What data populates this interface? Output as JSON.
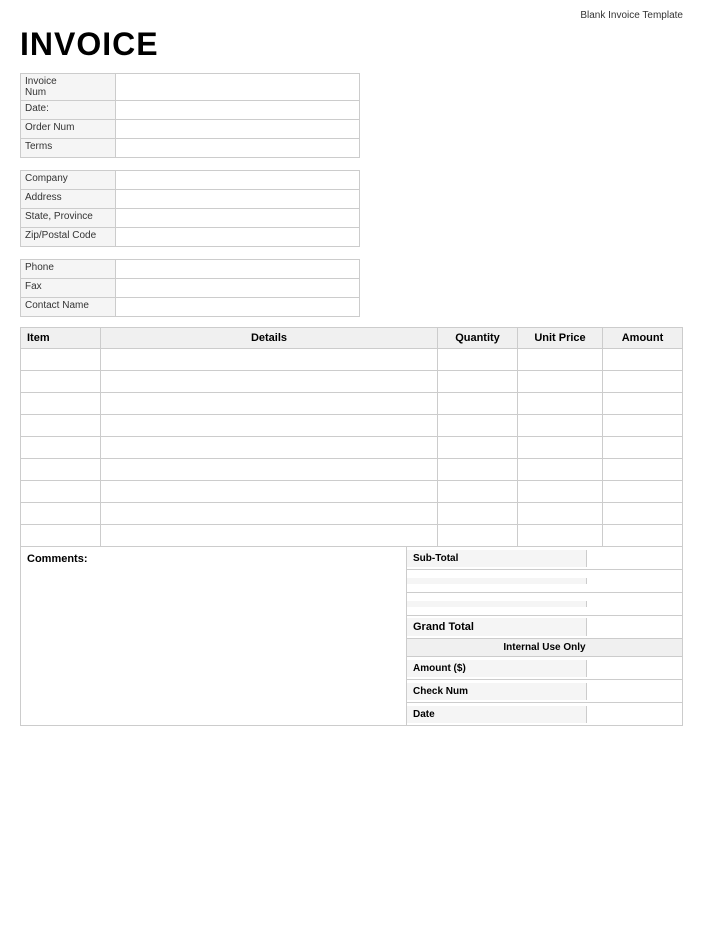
{
  "page": {
    "top_label": "Blank Invoice Template",
    "title": "INVOICE"
  },
  "info_sections": {
    "section1": [
      {
        "label": "Invoice\nNum",
        "value": ""
      },
      {
        "label": "Date:",
        "value": ""
      },
      {
        "label": "Order Num",
        "value": ""
      },
      {
        "label": "Terms",
        "value": ""
      }
    ],
    "section2": [
      {
        "label": "Company",
        "value": ""
      },
      {
        "label": "Address",
        "value": ""
      },
      {
        "label": "State, Province",
        "value": ""
      },
      {
        "label": "Zip/Postal Code",
        "value": ""
      }
    ],
    "section3": [
      {
        "label": "Phone",
        "value": ""
      },
      {
        "label": "Fax",
        "value": ""
      },
      {
        "label": "Contact Name",
        "value": ""
      }
    ]
  },
  "table": {
    "headers": {
      "item": "Item",
      "details": "Details",
      "quantity": "Quantity",
      "unit_price": "Unit Price",
      "amount": "Amount"
    },
    "rows": [
      {
        "item": "",
        "details": "",
        "quantity": "",
        "unit_price": "",
        "amount": ""
      },
      {
        "item": "",
        "details": "",
        "quantity": "",
        "unit_price": "",
        "amount": ""
      },
      {
        "item": "",
        "details": "",
        "quantity": "",
        "unit_price": "",
        "amount": ""
      },
      {
        "item": "",
        "details": "",
        "quantity": "",
        "unit_price": "",
        "amount": ""
      },
      {
        "item": "",
        "details": "",
        "quantity": "",
        "unit_price": "",
        "amount": ""
      },
      {
        "item": "",
        "details": "",
        "quantity": "",
        "unit_price": "",
        "amount": ""
      },
      {
        "item": "",
        "details": "",
        "quantity": "",
        "unit_price": "",
        "amount": ""
      },
      {
        "item": "",
        "details": "",
        "quantity": "",
        "unit_price": "",
        "amount": ""
      },
      {
        "item": "",
        "details": "",
        "quantity": "",
        "unit_price": "",
        "amount": ""
      }
    ]
  },
  "comments_label": "Comments:",
  "totals": {
    "subtotal_label": "Sub-Total",
    "subtotal_value": "",
    "spacer1": "",
    "spacer2": "",
    "grand_total_label": "Grand Total",
    "grand_total_value": "",
    "internal_header": "Internal Use Only",
    "amount_label": "Amount ($)",
    "amount_value": "",
    "check_label": "Check Num",
    "check_value": "",
    "date_label": "Date",
    "date_value": ""
  }
}
